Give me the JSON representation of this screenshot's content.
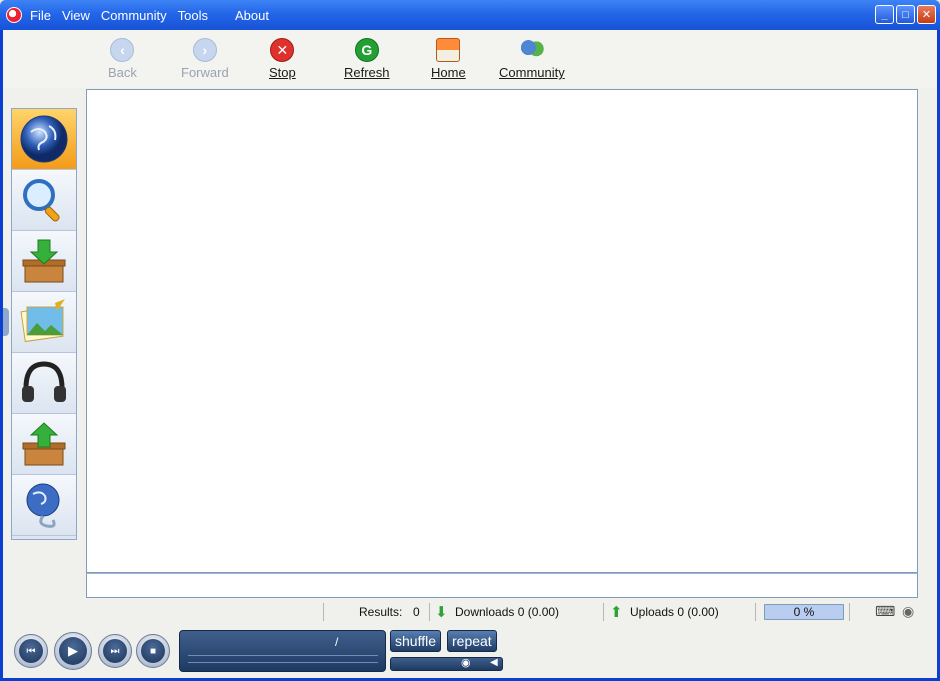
{
  "menu": [
    "File",
    "View",
    "Community",
    "Tools",
    "About"
  ],
  "toolbar": {
    "back": {
      "label": "Back",
      "icon": "back-arrow-icon"
    },
    "forward": {
      "label": "Forward",
      "icon": "forward-arrow-icon"
    },
    "stop": {
      "label": "Stop",
      "icon": "stop-icon"
    },
    "refresh": {
      "label": "Refresh",
      "icon": "refresh-icon"
    },
    "home": {
      "label": "Home",
      "icon": "home-icon"
    },
    "community": {
      "label": "Community",
      "icon": "community-icon"
    }
  },
  "sidebar": {
    "items": [
      "globe-icon",
      "magnifier-icon",
      "download-box-icon",
      "picture-icon",
      "headphones-icon",
      "upload-box-icon",
      "network-globe-icon"
    ]
  },
  "status": {
    "results_label": "Results:",
    "results_value": "0",
    "downloads": "Downloads 0 (0.00)",
    "uploads": "Uploads 0 (0.00)",
    "progress": "0 %"
  },
  "player": {
    "time": "/",
    "shuffle": "shuffle",
    "repeat": "repeat"
  },
  "colors": {
    "titlebar": "#2466e8",
    "sidebar_active": "#f39b19",
    "progress_fill": "#b9cdf0"
  }
}
